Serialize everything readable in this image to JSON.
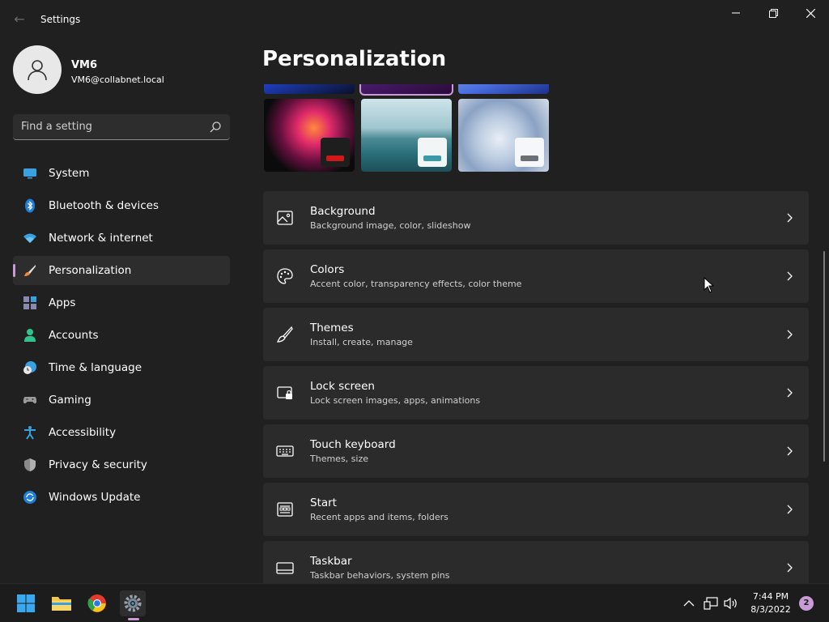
{
  "window": {
    "title": "Settings",
    "back_glyph": "←"
  },
  "profile": {
    "name": "VM6",
    "email": "VM6@collabnet.local"
  },
  "search": {
    "placeholder": "Find a setting"
  },
  "sidebar": {
    "items": [
      {
        "label": "System",
        "icon": "system-icon",
        "active": false
      },
      {
        "label": "Bluetooth & devices",
        "icon": "bluetooth-icon",
        "active": false
      },
      {
        "label": "Network & internet",
        "icon": "wifi-icon",
        "active": false
      },
      {
        "label": "Personalization",
        "icon": "brush-icon",
        "active": true
      },
      {
        "label": "Apps",
        "icon": "apps-icon",
        "active": false
      },
      {
        "label": "Accounts",
        "icon": "accounts-icon",
        "active": false
      },
      {
        "label": "Time & language",
        "icon": "clock-globe-icon",
        "active": false
      },
      {
        "label": "Gaming",
        "icon": "gamepad-icon",
        "active": false
      },
      {
        "label": "Accessibility",
        "icon": "accessibility-icon",
        "active": false
      },
      {
        "label": "Privacy & security",
        "icon": "shield-icon",
        "active": false
      },
      {
        "label": "Windows Update",
        "icon": "update-icon",
        "active": false
      }
    ]
  },
  "main": {
    "title": "Personalization",
    "cards": [
      {
        "title": "Background",
        "subtitle": "Background image, color, slideshow",
        "icon": "image-icon"
      },
      {
        "title": "Colors",
        "subtitle": "Accent color, transparency effects, color theme",
        "icon": "palette-icon"
      },
      {
        "title": "Themes",
        "subtitle": "Install, create, manage",
        "icon": "brush-icon"
      },
      {
        "title": "Lock screen",
        "subtitle": "Lock screen images, apps, animations",
        "icon": "lock-screen-icon"
      },
      {
        "title": "Touch keyboard",
        "subtitle": "Themes, size",
        "icon": "keyboard-icon"
      },
      {
        "title": "Start",
        "subtitle": "Recent apps and items, folders",
        "icon": "start-icon"
      },
      {
        "title": "Taskbar",
        "subtitle": "Taskbar behaviors, system pins",
        "icon": "taskbar-icon"
      }
    ]
  },
  "taskbar": {
    "time": "7:44 PM",
    "date": "8/3/2022",
    "notifications": "2"
  },
  "colors": {
    "accent": "#c99bd6",
    "background": "#202020",
    "card": "#2b2b2b"
  }
}
